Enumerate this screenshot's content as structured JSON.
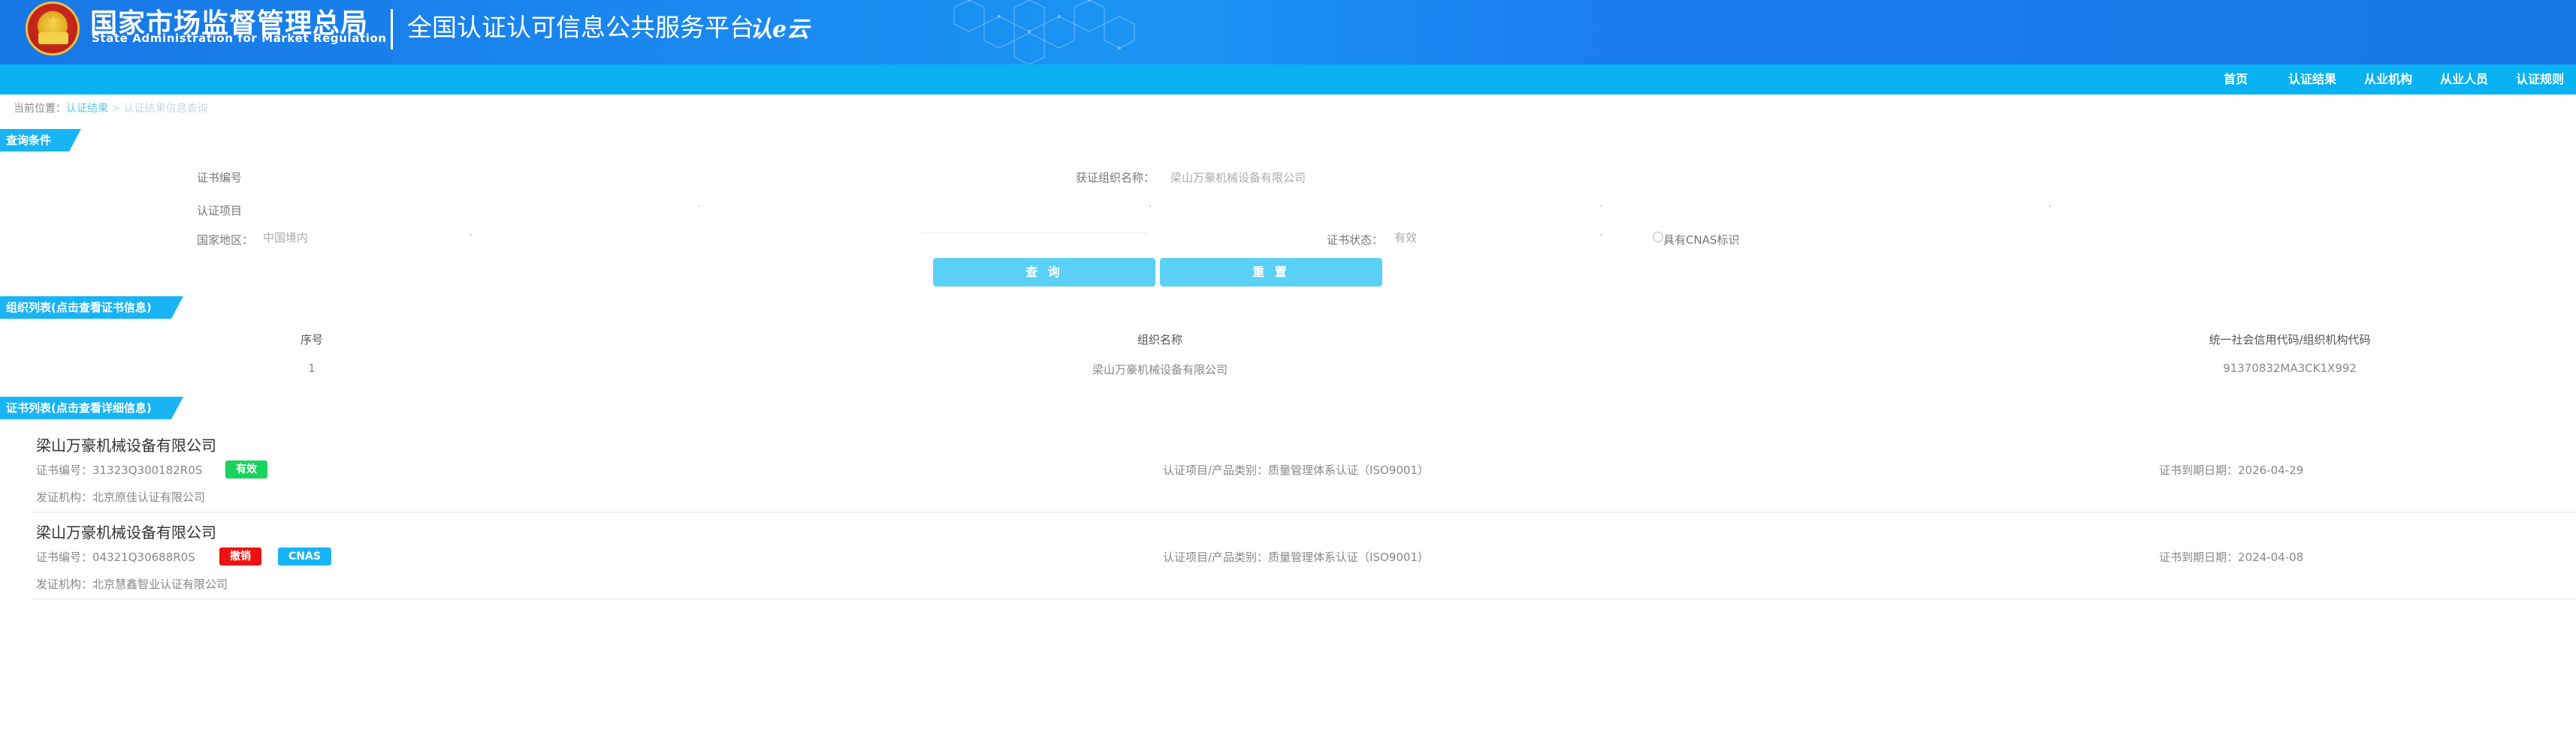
{
  "header": {
    "org_name_cn": "国家市场监督管理总局",
    "org_name_en": "State Administration  for  Market Regulation",
    "platform_title": "全国认证认可信息公共服务平台",
    "platform_logo_text": "认e云",
    "colors": {
      "banner": "#1a86ee",
      "nav": "#08b2f2",
      "accent": "#19b4f5"
    }
  },
  "nav": {
    "items": [
      "首页",
      "认证结果",
      "从业机构",
      "从业人员",
      "认证规则"
    ]
  },
  "breadcrumb": {
    "prefix": "当前位置：",
    "link": "认证结果",
    "separator": " > ",
    "current": "认证结果信息查询"
  },
  "query": {
    "section_title": "查询条件",
    "cert_no_label": "证书编号",
    "cert_no_value": "",
    "org_label": "获证组织名称：",
    "org_value": "梁山万豪机械设备有限公司",
    "project_label": "认证项目",
    "project_value": "",
    "region_label": "国家地区：",
    "region_value": "中国境内",
    "status_label": "证书状态：",
    "status_value": "有效",
    "cnas_label": "具有CNAS标识",
    "search_button": "查 询",
    "reset_button": "重 置"
  },
  "org_list": {
    "section_title": "组织列表(点击查看证书信息)",
    "columns": [
      "序号",
      "组织名称",
      "统一社会信用代码/组织机构代码"
    ],
    "rows": [
      [
        "1",
        "梁山万豪机械设备有限公司",
        "91370832MA3CK1X992"
      ]
    ]
  },
  "cert_list": {
    "section_title": "证书列表(点击查看详细信息)",
    "certs": [
      {
        "org_name": "梁山万豪机械设备有限公司",
        "cert_no": "证书编号：31323Q300182R0S",
        "status_badge": "有效",
        "status_color": "#19d35c",
        "cnas_badge": "",
        "project": "认证项目/产品类别：质量管理体系认证（ISO9001）",
        "expiry": "证书到期日期：2026-04-29",
        "issuer": "发证机构：北京原佳认证有限公司"
      },
      {
        "org_name": "梁山万豪机械设备有限公司",
        "cert_no": "证书编号：04321Q30688R0S",
        "status_badge": "撤销",
        "status_color": "#ee1111",
        "cnas_badge": "CNAS",
        "cnas_color": "#19b4f5",
        "project": "认证项目/产品类别：质量管理体系认证（ISO9001）",
        "expiry": "证书到期日期：2024-04-08",
        "issuer": "发证机构：北京慧鑫智业认证有限公司"
      }
    ]
  }
}
